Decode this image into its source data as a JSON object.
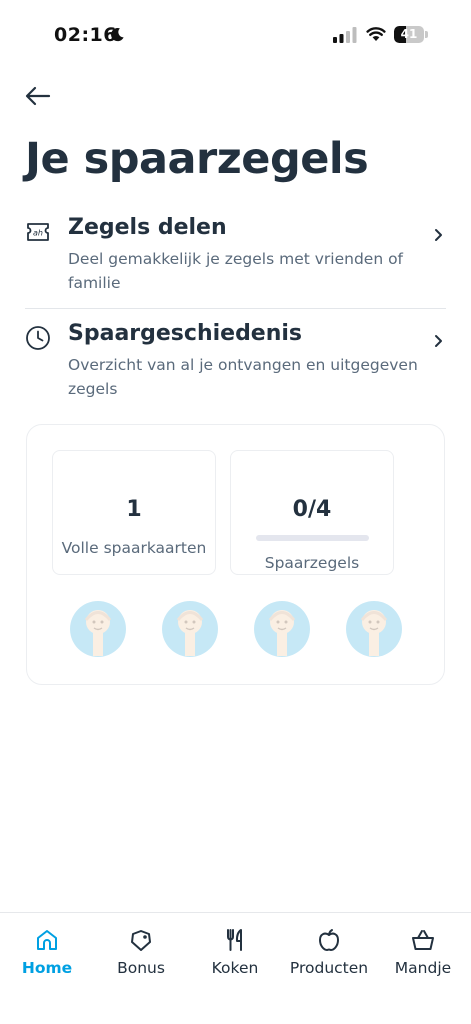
{
  "status_bar": {
    "time": "02:16",
    "battery": "41",
    "battery_level": 0.41
  },
  "page": {
    "title": "Je spaarzegels"
  },
  "menu": [
    {
      "title": "Zegels delen",
      "description": "Deel gemakkelijk je zegels met vrienden of familie",
      "icon": "ticket-icon"
    },
    {
      "title": "Spaargeschiedenis",
      "description": "Overzicht van al je ontvangen en uitgegeven zegels",
      "icon": "clock-icon"
    }
  ],
  "savings": {
    "full_cards_value": "1",
    "full_cards_label": "Volle spaarkaarten",
    "stamps_value": "0/4",
    "stamps_label": "Spaarzegels",
    "stamps_progress": 0,
    "stamp_icons": [
      "stamp-icon",
      "stamp-icon",
      "stamp-icon",
      "stamp-icon"
    ]
  },
  "bottom_nav": [
    {
      "label": "Home",
      "icon": "home-icon",
      "active": true
    },
    {
      "label": "Bonus",
      "icon": "bonus-tag-icon",
      "active": false
    },
    {
      "label": "Koken",
      "icon": "cutlery-icon",
      "active": false
    },
    {
      "label": "Producten",
      "icon": "apple-icon",
      "active": false
    },
    {
      "label": "Mandje",
      "icon": "basket-icon",
      "active": false
    }
  ],
  "colors": {
    "accent": "#00a0e2",
    "text_dark": "#23313f",
    "text_muted": "#5a6a7b"
  }
}
